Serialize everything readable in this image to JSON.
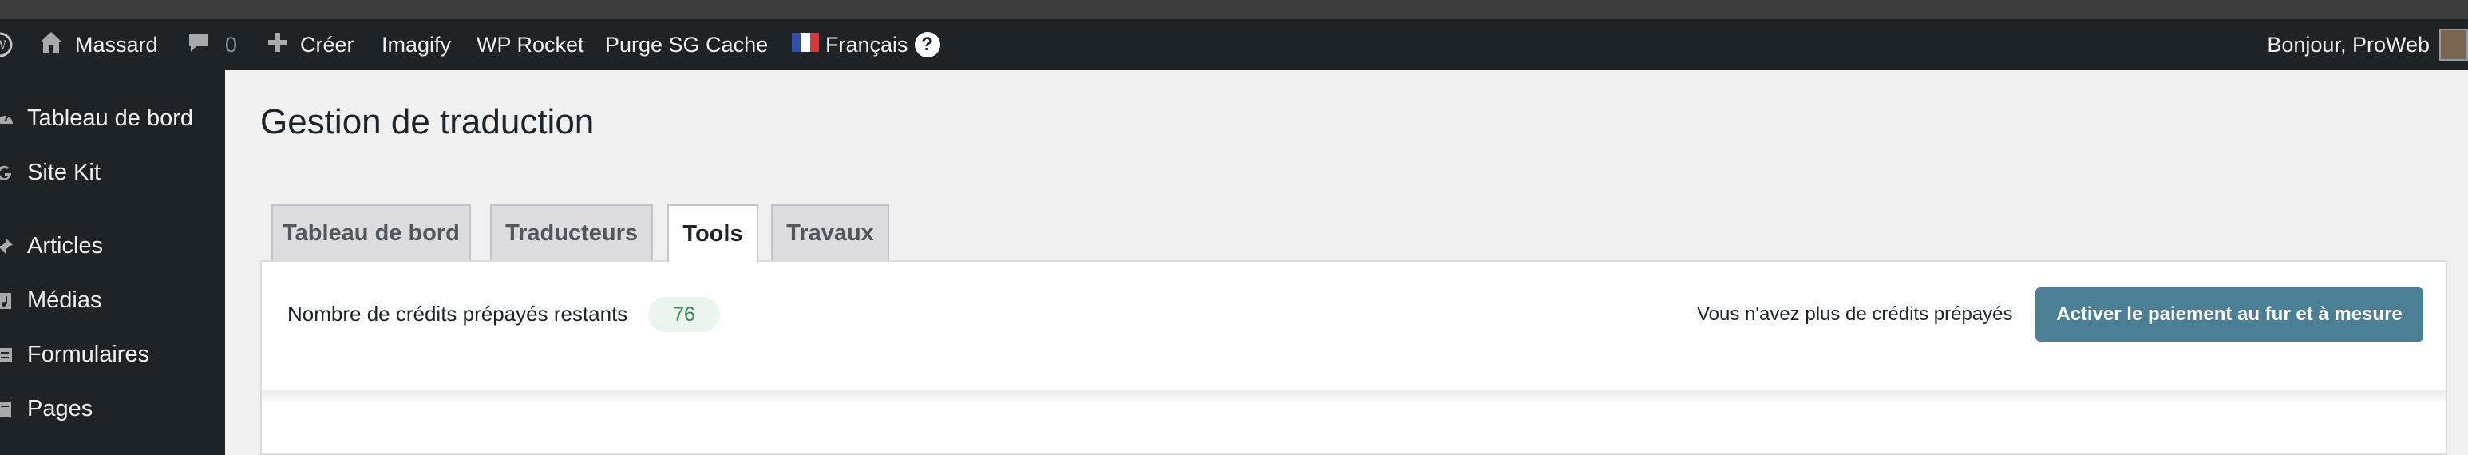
{
  "adminbar": {
    "site_name": "Massard",
    "comments_count": "0",
    "new_label": "Créer",
    "imagify": "Imagify",
    "wp_rocket": "WP Rocket",
    "purge_cache": "Purge SG Cache",
    "language": "Français",
    "help": "?",
    "greeting": "Bonjour, ProWeb"
  },
  "sidebar": {
    "items": [
      {
        "label": "Tableau de bord",
        "icon": "dashboard-icon"
      },
      {
        "label": "Site Kit",
        "icon": "google-g-icon"
      },
      {
        "label": "Articles",
        "icon": "pin-icon"
      },
      {
        "label": "Médias",
        "icon": "media-icon"
      },
      {
        "label": "Formulaires",
        "icon": "forms-icon"
      },
      {
        "label": "Pages",
        "icon": "page-icon"
      }
    ]
  },
  "page": {
    "title": "Gestion de traduction",
    "tabs": [
      {
        "label": "Tableau de bord"
      },
      {
        "label": "Traducteurs"
      },
      {
        "label": "Tools"
      },
      {
        "label": "Travaux"
      }
    ],
    "active_tab": "Tools"
  },
  "panel": {
    "credits_label": "Nombre de crédits prépayés restants",
    "credits_value": "76",
    "no_credits_text": "Vous n'avez plus de crédits prépayés",
    "pay_button": "Activer le paiement au fur et à mesure"
  },
  "colors": {
    "adminbar_bg": "#1d2327",
    "button_bg": "#4a7f96",
    "badge_bg": "#e9f5ee",
    "badge_text": "#2e8b57"
  }
}
